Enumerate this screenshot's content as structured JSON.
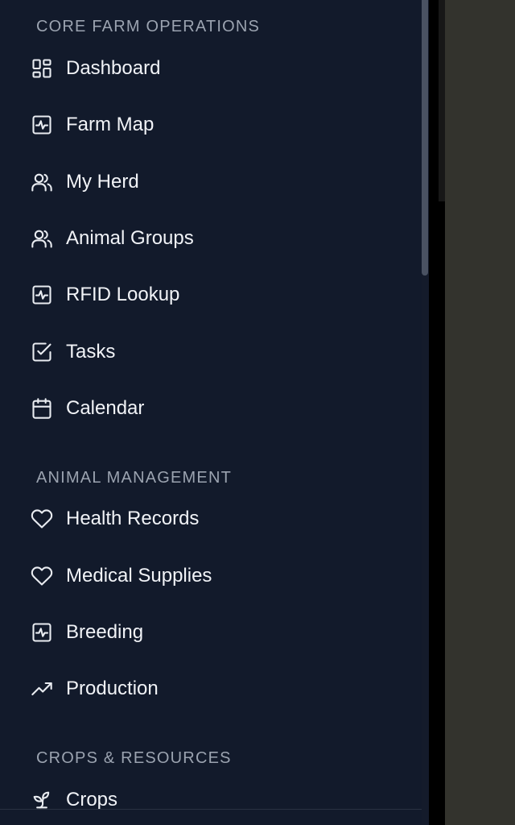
{
  "sections": [
    {
      "header": "CORE FARM OPERATIONS",
      "items": [
        {
          "label": "Dashboard",
          "icon": "dashboard-icon"
        },
        {
          "label": "Farm Map",
          "icon": "activity-icon"
        },
        {
          "label": "My Herd",
          "icon": "users-icon"
        },
        {
          "label": "Animal Groups",
          "icon": "users-icon"
        },
        {
          "label": "RFID Lookup",
          "icon": "activity-icon"
        },
        {
          "label": "Tasks",
          "icon": "check-square-icon"
        },
        {
          "label": "Calendar",
          "icon": "calendar-icon"
        }
      ]
    },
    {
      "header": "ANIMAL MANAGEMENT",
      "items": [
        {
          "label": "Health Records",
          "icon": "heart-icon"
        },
        {
          "label": "Medical Supplies",
          "icon": "heart-icon"
        },
        {
          "label": "Breeding",
          "icon": "activity-icon"
        },
        {
          "label": "Production",
          "icon": "trending-up-icon"
        }
      ]
    },
    {
      "header": "CROPS & RESOURCES",
      "items": [
        {
          "label": "Crops",
          "icon": "sprout-icon"
        }
      ]
    }
  ],
  "colors": {
    "drawer_bg": "#121a2b",
    "text": "#f1f3f7",
    "section_header": "#9ba3b0",
    "overlay": "#33332d"
  }
}
